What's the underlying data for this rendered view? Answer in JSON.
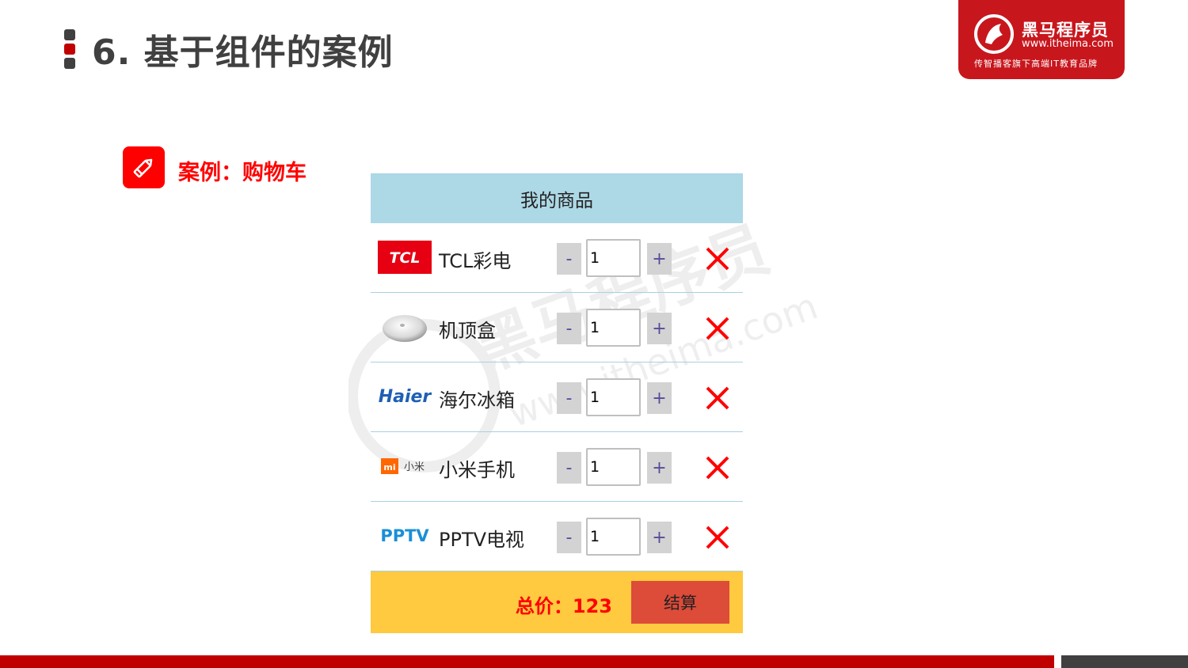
{
  "slide": {
    "title": "6. 基于组件的案例",
    "case_label": "案例：购物车"
  },
  "logo": {
    "name": "黑马程序员",
    "url": "www.itheima.com",
    "slogan": "传智播客旗下高端IT教育品牌"
  },
  "cart": {
    "header": "我的商品",
    "items": [
      {
        "brand": "TCL",
        "name": "TCL彩电",
        "quantity": "1",
        "minus": "-",
        "plus": "+"
      },
      {
        "brand": "set-top-box-image",
        "name": "机顶盒",
        "quantity": "1",
        "minus": "-",
        "plus": "+"
      },
      {
        "brand": "Haier",
        "name": "海尔冰箱",
        "quantity": "1",
        "minus": "-",
        "plus": "+"
      },
      {
        "brand": "mi 小米",
        "name": "小米手机",
        "quantity": "1",
        "minus": "-",
        "plus": "+"
      },
      {
        "brand": "PPTV",
        "name": "PPTV电视",
        "quantity": "1",
        "minus": "-",
        "plus": "+"
      }
    ],
    "total_label": "总价：123",
    "checkout_label": "结算"
  },
  "colors": {
    "accent_red": "#c00000",
    "header_bg": "#add8e6",
    "footer_bg": "#ffc940",
    "checkout_bg": "#dd4b39",
    "delete_red": "#ff0000"
  }
}
